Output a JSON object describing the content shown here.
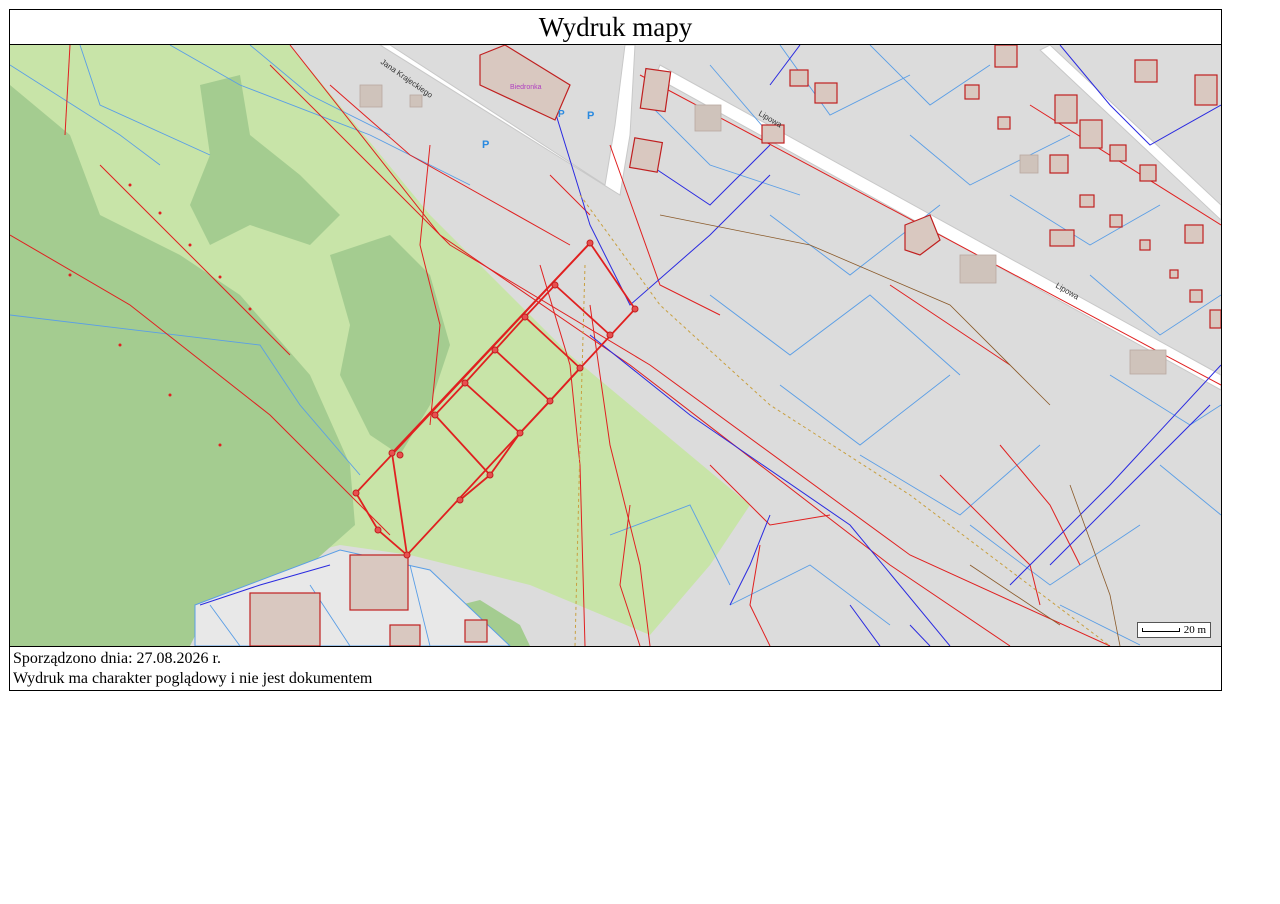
{
  "title": "Wydruk mapy",
  "footer": {
    "created_label": "Sporządzono dnia: 27.08.2026 r.",
    "disclaimer": "Wydruk ma charakter poglądowy i nie jest dokumentem"
  },
  "scale": {
    "label": "20 m"
  },
  "map_labels": {
    "street_krajeckiego": "Jana Krajeckiego",
    "street_lipowa_1": "Lipowa",
    "street_lipowa_2": "Lipowa",
    "shop": "Biedronka",
    "parking": "P"
  },
  "colors": {
    "background_urban": "#dcdcdc",
    "park_light": "#c8e4a8",
    "forest_dark": "#a4cc90",
    "parcel_lines": "#5a9ee6",
    "utility_red": "#e02020",
    "utility_blue": "#2a2ae0",
    "building_fill": "#d9c8c0",
    "building_outline": "#c02020"
  }
}
